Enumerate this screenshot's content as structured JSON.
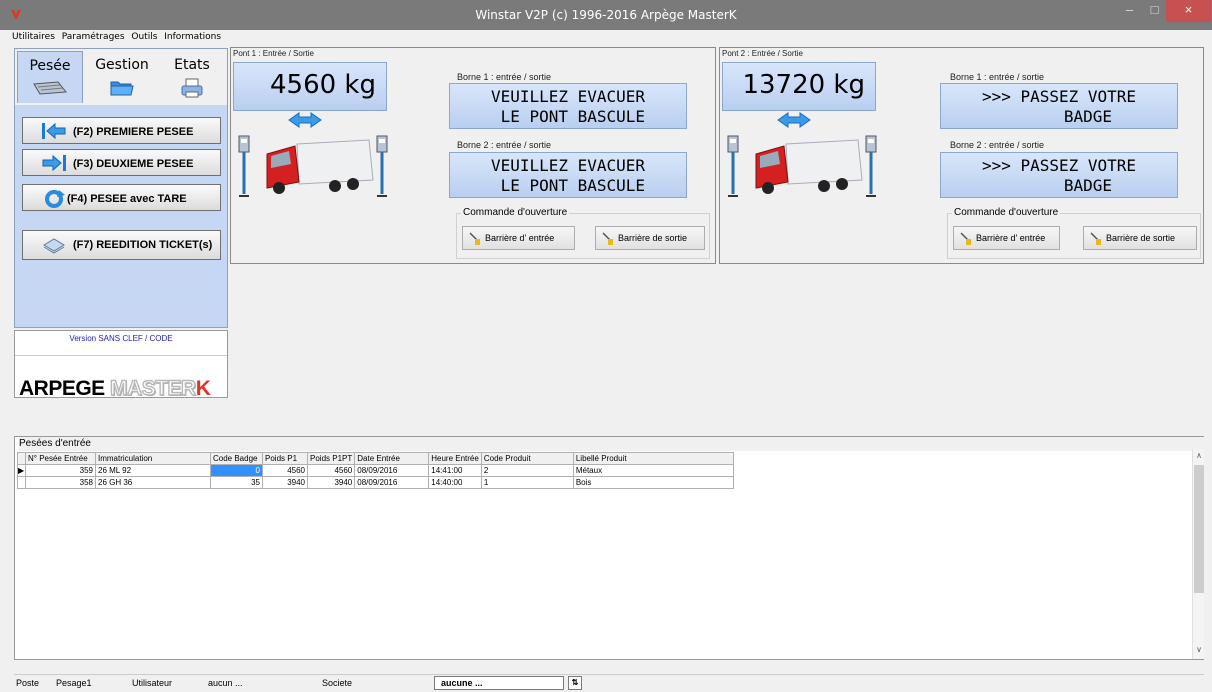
{
  "window": {
    "title": "Winstar V2P (c) 1996-2016 Arpège MasterK",
    "minimize": "‒",
    "maximize": "□",
    "close": "×"
  },
  "menu": [
    "Utilitaires",
    "Paramétrages",
    "Outils",
    "Informations"
  ],
  "tabs": {
    "pesee": "Pesée",
    "gestion": "Gestion",
    "etats": "Etats"
  },
  "actions": {
    "premiere": "(F2) PREMIERE PESEE",
    "deuxieme": "(F3) DEUXIEME PESEE",
    "tare": "(F4) PESEE avec TARE",
    "reedition": "(F7) REEDITION TICKET(s)"
  },
  "version": "Version SANS CLEF / CODE",
  "logo": {
    "arpege": "ARPEGE ",
    "master": "MASTER",
    "k": "K"
  },
  "ponts": [
    {
      "label": "Pont 1 : Entrée / Sortie",
      "weight": "4560 kg",
      "borne1_label": "Borne 1 : entrée / sortie",
      "borne1_text": "VEUILLEZ EVACUER\n LE PONT BASCULE",
      "borne2_label": "Borne 2 : entrée / sortie",
      "borne2_text": "VEUILLEZ EVACUER\n LE PONT BASCULE",
      "cmd_label": "Commande d'ouverture",
      "btn_entree": "Barrière d' entrée",
      "btn_sortie": "Barrière de sortie"
    },
    {
      "label": "Pont 2 : Entrée / Sortie",
      "weight": "13720 kg",
      "borne1_label": "Borne 1 : entrée / sortie",
      "borne1_text": ">>> PASSEZ VOTRE\n      BADGE",
      "borne2_label": "Borne 2 : entrée / sortie",
      "borne2_text": ">>> PASSEZ VOTRE\n      BADGE",
      "cmd_label": "Commande d'ouverture",
      "btn_entree": "Barrière d' entrée",
      "btn_sortie": "Barrière de sortie"
    }
  ],
  "grid": {
    "title": "Pesées d'entrée",
    "columns": [
      "N° Pesée Entrée",
      "Immatriculation",
      "Code Badge",
      "Poids P1",
      "Poids P1PT",
      "Date Entrée",
      "Heure Entrée",
      "Code Produit",
      "Libellé Produit"
    ],
    "rows": [
      [
        "359",
        "26 ML 92",
        "0",
        "4560",
        "4560",
        "08/09/2016",
        "14:41:00",
        "2",
        "Métaux"
      ],
      [
        "358",
        "26 GH 36",
        "35",
        "3940",
        "3940",
        "08/09/2016",
        "14:40:00",
        "1",
        "Bois"
      ]
    ]
  },
  "status": {
    "poste_label": "Poste",
    "poste": "Pesage1",
    "user_label": "Utilisateur",
    "user": "aucun ...",
    "societe_label": "Societe",
    "societe": "aucune ..."
  },
  "colors": {
    "panel": "#c5d7f2",
    "display": "#c9dbf6",
    "truck": "#d42020"
  }
}
